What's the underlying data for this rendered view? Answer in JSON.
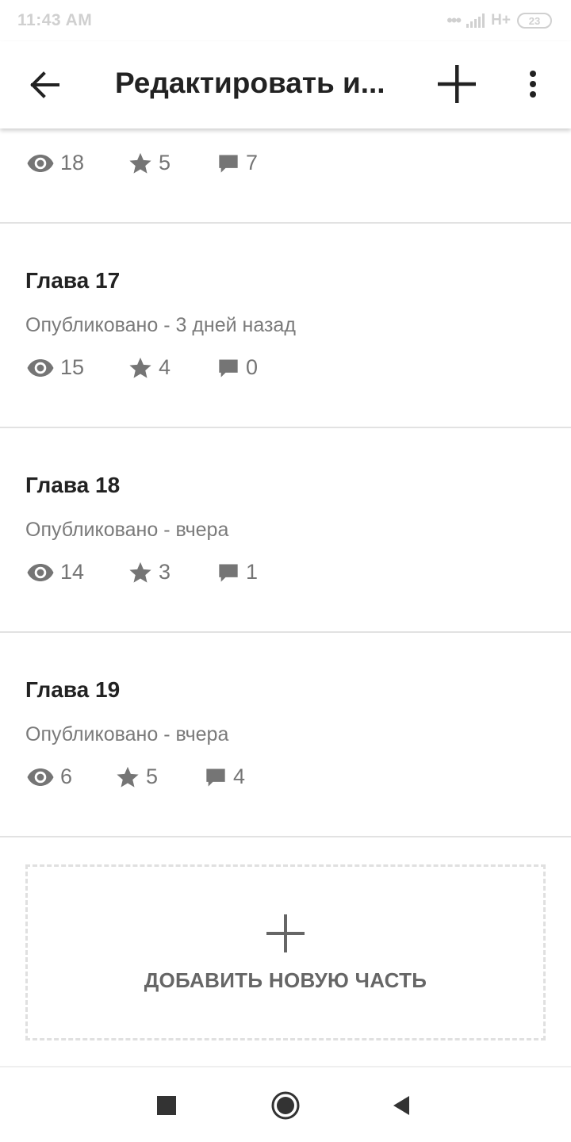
{
  "status_bar": {
    "time": "11:43 AM",
    "network": "H+",
    "battery": "23"
  },
  "app_bar": {
    "title": "Редактировать и..."
  },
  "parts": [
    {
      "title": "",
      "status": "",
      "views": "18",
      "votes": "5",
      "comments": "7"
    },
    {
      "title": "Глава 17",
      "status": "Опубликовано - 3 дней назад",
      "views": "15",
      "votes": "4",
      "comments": "0"
    },
    {
      "title": "Глава 18",
      "status": "Опубликовано - вчера",
      "views": "14",
      "votes": "3",
      "comments": "1"
    },
    {
      "title": "Глава 19",
      "status": "Опубликовано - вчера",
      "views": "6",
      "votes": "5",
      "comments": "4"
    }
  ],
  "add_part": {
    "label": "ДОБАВИТЬ НОВУЮ ЧАСТЬ"
  },
  "icons": {
    "back": "arrow-left-icon",
    "add": "plus-icon",
    "more": "more-vert-icon",
    "views": "eye-icon",
    "votes": "star-icon",
    "comments": "comment-icon"
  },
  "colors": {
    "text_primary": "#222222",
    "text_secondary": "#757575",
    "divider": "#e2e2e2",
    "status_bar_text": "#d0d0d0"
  }
}
